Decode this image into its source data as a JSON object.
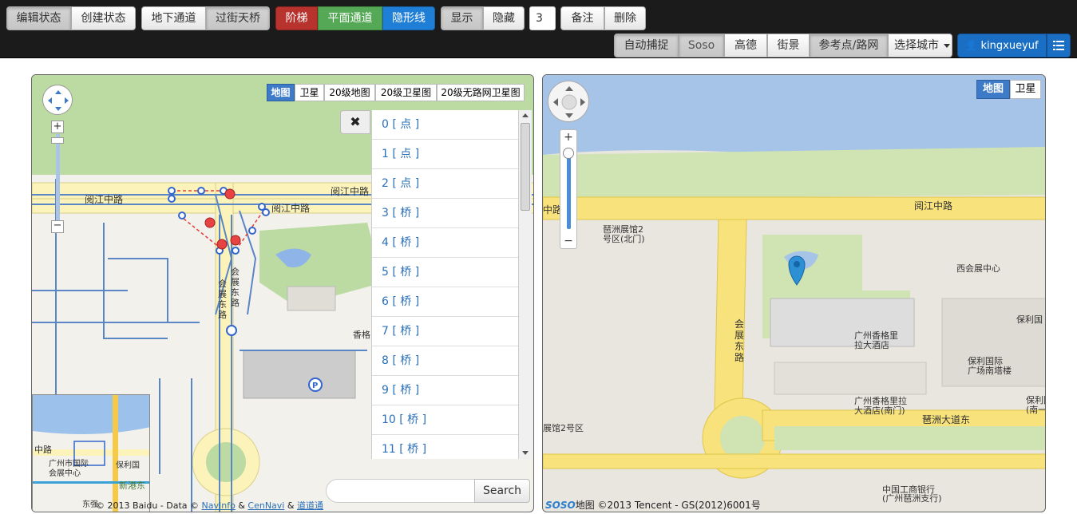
{
  "toolbar": {
    "edit_state": "编辑状态",
    "create_state": "创建状态",
    "underground": "地下通道",
    "overpass": "过街天桥",
    "stairs": "阶梯",
    "flat": "平面通道",
    "hidden_line": "隐形线",
    "show": "显示",
    "hide": "隐藏",
    "count": "3",
    "note": "备注",
    "delete": "删除",
    "auto_capture": "自动捕捉",
    "soso": "Soso",
    "gaode": "高德",
    "street_view": "街景",
    "ref_points": "参考点/路网",
    "select_city": "选择城市",
    "username": "kingxueyuf"
  },
  "left_map": {
    "types": [
      "地图",
      "卫星",
      "20级地图",
      "20级卫星图",
      "20级无路网卫星图"
    ],
    "road_labels": [
      "阅江中路",
      "阅江中路",
      "阅江中路",
      "会展东路",
      "会展东路",
      "香格"
    ],
    "list_items": [
      "0 [ 点 ]",
      "1 [ 点 ]",
      "2 [ 点 ]",
      "3 [ 桥 ]",
      "4 [ 桥 ]",
      "5 [ 桥 ]",
      "6 [ 桥 ]",
      "7 [ 桥 ]",
      "8 [ 桥 ]",
      "9 [ 桥 ]",
      "10 [ 桥 ]",
      "11 [ 桥 ]"
    ],
    "search_label": "Search",
    "search_placeholder": "",
    "overview_labels": [
      "中路",
      "广州市国际",
      "会展中心",
      "保利国",
      "新港东",
      "东强"
    ],
    "copyright_prefix": "© 2013 Baidu - Data ©",
    "copyright_navinfo": "NavInfo",
    "copyright_amp1": "&",
    "copyright_cennavi": "CenNavi",
    "copyright_amp2": "&",
    "copyright_daodao": "道道通"
  },
  "right_map": {
    "types": [
      "地图",
      "卫星"
    ],
    "labels": [
      "阅江中路",
      "中路",
      "琶洲展馆2",
      "号区(北门)",
      "西会展中心",
      "保利国",
      "会展东路",
      "广州香格里",
      "拉大酒店",
      "保利国际",
      "广场南塔楼",
      "广州香格里拉",
      "大酒店(南门)",
      "琶洲大道东",
      "展馆2号区",
      "中国工商银行",
      "(广州琶洲支行)",
      "保利国",
      "(南一"
    ],
    "logo": "SOSO",
    "logo_suffix": "地图",
    "copyright": "©2013 Tencent - GS(2012)6001号"
  }
}
